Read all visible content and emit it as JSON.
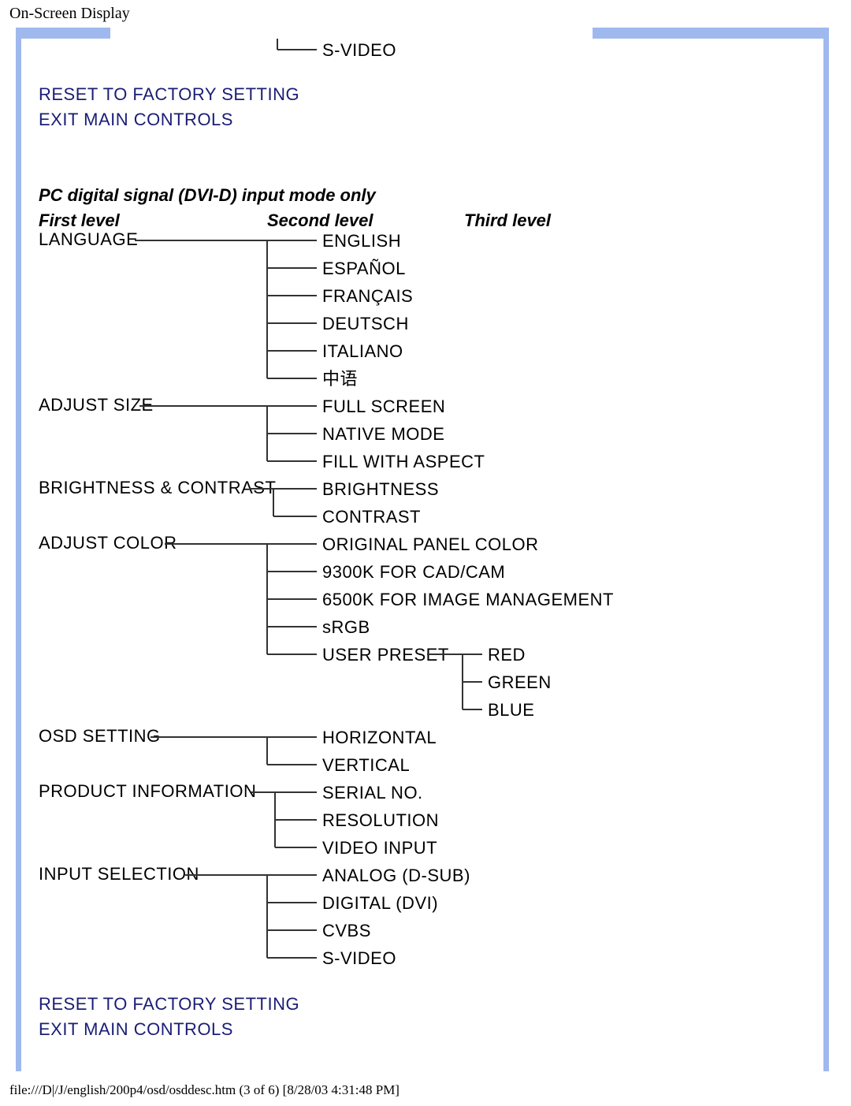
{
  "header": {
    "title": "On-Screen Display"
  },
  "top": {
    "svideo": "S-VIDEO",
    "reset": "RESET TO FACTORY SETTING",
    "exit": "EXIT MAIN CONTROLS"
  },
  "section": {
    "title": "PC digital signal (DVI-D) input mode only",
    "col1": "First level",
    "col2": "Second level",
    "col3": "Third level"
  },
  "tree": {
    "language": {
      "label": "LANGUAGE",
      "items": [
        "ENGLISH",
        "ESPAÑOL",
        "FRANÇAIS",
        "DEUTSCH",
        "ITALIANO",
        "中语"
      ]
    },
    "adjust_size": {
      "label": "ADJUST SIZE",
      "items": [
        "FULL SCREEN",
        "NATIVE MODE",
        "FILL WITH ASPECT"
      ]
    },
    "brightness_contrast": {
      "label": "BRIGHTNESS & CONTRAST",
      "items": [
        "BRIGHTNESS",
        "CONTRAST"
      ]
    },
    "adjust_color": {
      "label": "ADJUST COLOR",
      "items": [
        "ORIGINAL PANEL COLOR",
        "9300K FOR CAD/CAM",
        "6500K FOR IMAGE MANAGEMENT",
        "sRGB",
        "USER PRESET"
      ],
      "user_preset_children": [
        "RED",
        "GREEN",
        "BLUE"
      ]
    },
    "osd_setting": {
      "label": "OSD SETTING",
      "items": [
        "HORIZONTAL",
        "VERTICAL"
      ]
    },
    "product_info": {
      "label": "PRODUCT INFORMATION",
      "items": [
        "SERIAL NO.",
        "RESOLUTION",
        "VIDEO INPUT"
      ]
    },
    "input_selection": {
      "label": "INPUT SELECTION",
      "items": [
        "ANALOG (D-SUB)",
        "DIGITAL (DVI)",
        "CVBS",
        "S-VIDEO"
      ]
    },
    "reset": "RESET TO FACTORY SETTING",
    "exit": "EXIT MAIN CONTROLS"
  },
  "footer": {
    "path": "file:///D|/J/english/200p4/osd/osddesc.htm (3 of 6) [8/28/03 4:31:48 PM]"
  }
}
